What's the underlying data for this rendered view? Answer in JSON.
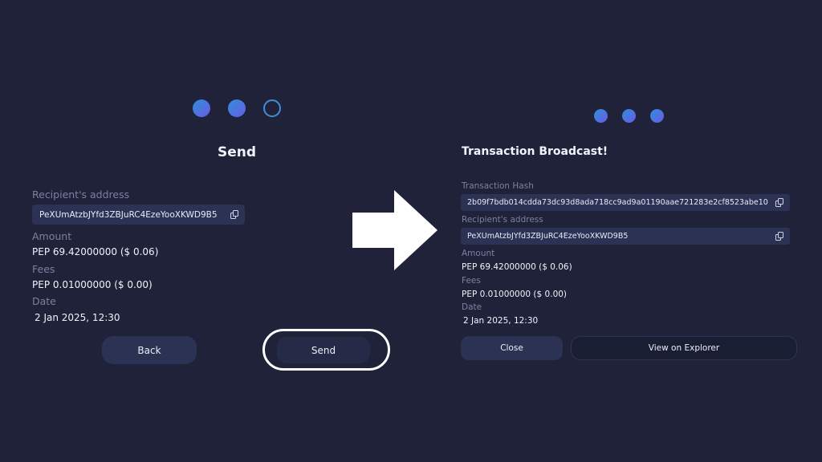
{
  "send_screen": {
    "step_indicator": [
      "filled",
      "filled",
      "empty"
    ],
    "title": "Send",
    "recipient_label": "Recipient's address",
    "recipient_address": "PeXUmAtzbJYfd3ZBJuRC4EzeYooXKWD9B5",
    "amount_label": "Amount",
    "amount_value": "PEP 69.42000000 ($ 0.06)",
    "fees_label": "Fees",
    "fees_value": "PEP 0.01000000 ($ 0.00)",
    "date_label": "Date",
    "date_value": "2 Jan 2025, 12:30",
    "back_label": "Back",
    "send_label": "Send"
  },
  "broadcast_screen": {
    "step_indicator": [
      "filled",
      "filled",
      "filled"
    ],
    "title": "Transaction Broadcast!",
    "hash_label": "Transaction Hash",
    "hash_value": "2b09f7bdb014cdda73dc93d8ada718cc9ad9a01190aae721283e2cf8523abe10",
    "recipient_label": "Recipient's address",
    "recipient_address": "PeXUmAtzbJYfd3ZBJuRC4EzeYooXKWD9B5",
    "amount_label": "Amount",
    "amount_value": "PEP 69.42000000 ($ 0.06)",
    "fees_label": "Fees",
    "fees_value": "PEP 0.01000000 ($ 0.00)",
    "date_label": "Date",
    "date_value": "2 Jan 2025, 12:30",
    "close_label": "Close",
    "explorer_label": "View on Explorer"
  },
  "icons": {
    "transition_arrow": "right-arrow-icon",
    "copy": "copy-icon"
  },
  "colors": {
    "background": "#1f2239",
    "field_background": "#2b3254",
    "dot_gradient_start": "#2f8fd8",
    "dot_gradient_end": "#6a5be8",
    "label_text": "#7c819e",
    "highlight_ring": "#ffffff"
  }
}
